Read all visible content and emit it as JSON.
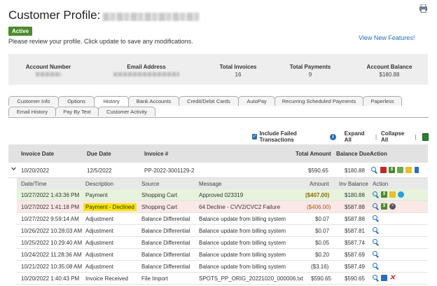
{
  "header": {
    "title": "Customer Profile:",
    "status": "Active",
    "review_text": "Please review your profile. Click update to save any modifications.",
    "new_features": "View New Features!"
  },
  "summary": {
    "account_number_label": "Account Number",
    "email_label": "Email Address",
    "total_invoices_label": "Total Invoices",
    "total_invoices": "16",
    "total_payments_label": "Total Payments",
    "total_payments": "9",
    "account_balance_label": "Account Balance",
    "account_balance": "$180.88"
  },
  "tabs": {
    "row1": [
      "Customer Info",
      "Options",
      "History",
      "Bank Accounts",
      "Credit/Debit Cards",
      "AutoPay",
      "Recurring Scheduled Payments",
      "Paperless"
    ],
    "row2": [
      "Email History",
      "Pay By Text",
      "Customer Activity"
    ],
    "active": "History"
  },
  "toolbar": {
    "include_failed": "Include Failed Transactions",
    "expand_all": "Expand All",
    "collapse_all": "Collapse All",
    "separator": "|"
  },
  "main_table": {
    "headers": {
      "invoice_date": "Invoice Date",
      "due_date": "Due Date",
      "invoice_no": "Invoice #",
      "total_amount": "Total Amount",
      "balance_due": "Balance Due",
      "action": "Action"
    },
    "row": {
      "invoice_date": "10/20/2022",
      "due_date": "12/5/2022",
      "invoice_no": "PP-2022-3001129-2",
      "total_amount": "$590.65",
      "balance_due": "$180.88"
    }
  },
  "detail_table": {
    "headers": {
      "datetime": "Date/Time",
      "description": "Description",
      "source": "Source",
      "message": "Message",
      "amount": "Amount",
      "inv_balance": "Inv Balance",
      "action": "Action"
    },
    "rows": [
      {
        "datetime": "10/27/2022 1:43:36 PM",
        "description": "Payment",
        "source": "Shopping Cart",
        "message": "Approved 023319",
        "amount": "($407.00)",
        "inv_balance": "$180.88"
      },
      {
        "datetime": "10/27/2022 1:41:18 PM",
        "description": "Payment - Declined",
        "source": "Shopping Cart",
        "message": "64 Decline - CVV2/CVC2 Failure",
        "amount": "($406.00)",
        "inv_balance": "$587.88"
      },
      {
        "datetime": "10/27/2022 9:59:14 AM",
        "description": "Adjustment",
        "source": "Balance Differential",
        "message": "Balance update from billing system",
        "amount": "$0.07",
        "inv_balance": "$587.88"
      },
      {
        "datetime": "10/26/2022 10:28:03 AM",
        "description": "Adjustment",
        "source": "Balance Differential",
        "message": "Balance update from billing system",
        "amount": "$0.07",
        "inv_balance": "$587.81"
      },
      {
        "datetime": "10/25/2022 10:29:40 AM",
        "description": "Adjustment",
        "source": "Balance Differential",
        "message": "Balance update from billing system",
        "amount": "$0.05",
        "inv_balance": "$587.74"
      },
      {
        "datetime": "10/24/2022 11:28:36 AM",
        "description": "Adjustment",
        "source": "Balance Differential",
        "message": "Balance update from billing system",
        "amount": "$0.20",
        "inv_balance": "$587.69"
      },
      {
        "datetime": "10/21/2022 10:35:08 AM",
        "description": "Adjustment",
        "source": "Balance Differential",
        "message": "Balance update from billing system",
        "amount": "($3.16)",
        "inv_balance": "$587.49"
      },
      {
        "datetime": "10/20/2022 1:40:43 PM",
        "description": "Invoice Received",
        "source": "File Import",
        "message": "SPOTS_PP_ORIG_20221020_000006.txt",
        "amount": "$590.65",
        "inv_balance": "$590.65"
      }
    ]
  },
  "icons": {
    "print": "printer-icon",
    "info": "info-icon",
    "excel": "excel-export-icon",
    "view": "magnifier-icon"
  },
  "colors": {
    "status_green": "#4c8a2e",
    "link_blue": "#2a6ebb",
    "highlight_yellow": "#f6e600",
    "paid_row": "#e7f3dc",
    "declined_row": "#fde8e8"
  }
}
